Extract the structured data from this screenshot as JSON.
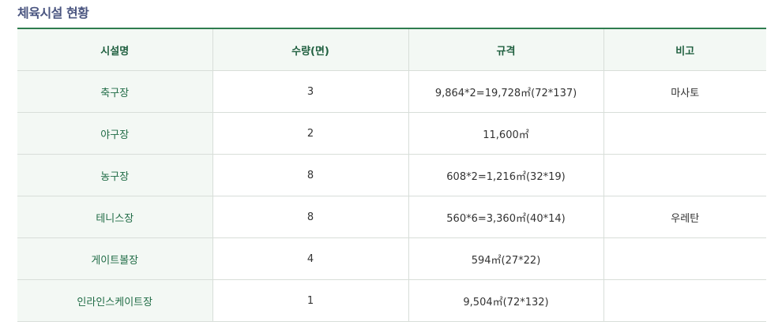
{
  "section": {
    "title": "체육시설 현황"
  },
  "table": {
    "headers": {
      "name": "시설명",
      "quantity": "수량(면)",
      "spec": "규격",
      "note": "비고"
    },
    "rows": [
      {
        "name": "축구장",
        "quantity": "3",
        "spec": "9,864*2=19,728㎡(72*137)",
        "note": "마사토"
      },
      {
        "name": "야구장",
        "quantity": "2",
        "spec": "11,600㎡",
        "note": ""
      },
      {
        "name": "농구장",
        "quantity": "8",
        "spec": "608*2=1,216㎡(32*19)",
        "note": ""
      },
      {
        "name": "테니스장",
        "quantity": "8",
        "spec": "560*6=3,360㎡(40*14)",
        "note": "우레탄"
      },
      {
        "name": "게이트볼장",
        "quantity": "4",
        "spec": "594㎡(27*22)",
        "note": ""
      },
      {
        "name": "인라인스케이트장",
        "quantity": "1",
        "spec": "9,504㎡(72*132)",
        "note": ""
      }
    ]
  }
}
